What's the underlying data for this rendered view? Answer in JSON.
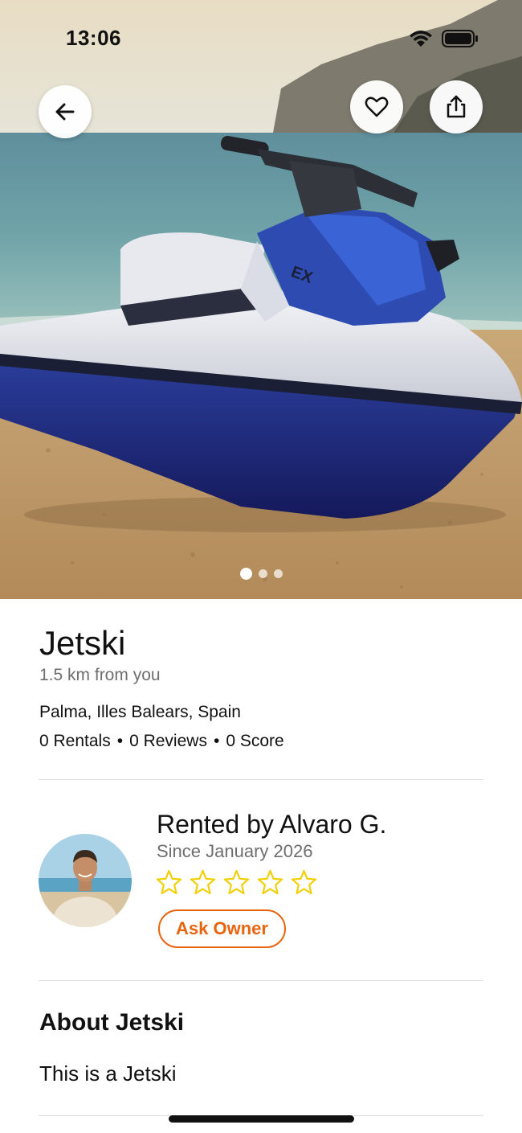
{
  "status_bar": {
    "time": "13:06"
  },
  "hero": {
    "image_description_icon": "jetski-photo",
    "carousel": {
      "count": 3,
      "active_index": 0
    }
  },
  "actions": {
    "back_icon": "arrow-left-icon",
    "favorite_icon": "heart-icon",
    "share_icon": "share-icon"
  },
  "listing": {
    "title": "Jetski",
    "distance": "1.5 km from you",
    "location": "Palma, Illes Balears, Spain",
    "rentals": "0 Rentals",
    "reviews": "0 Reviews",
    "score": "0 Score",
    "separator": "•"
  },
  "owner": {
    "name": "Rented by Alvaro G.",
    "since": "Since January 2026",
    "rating": 0,
    "rating_max": 5,
    "ask_label": "Ask Owner"
  },
  "about": {
    "title": "About Jetski",
    "text": "This is a Jetski"
  },
  "colors": {
    "accent": "#e8640e",
    "star": "#f2cf00",
    "muted_text": "#6e6e6e"
  }
}
